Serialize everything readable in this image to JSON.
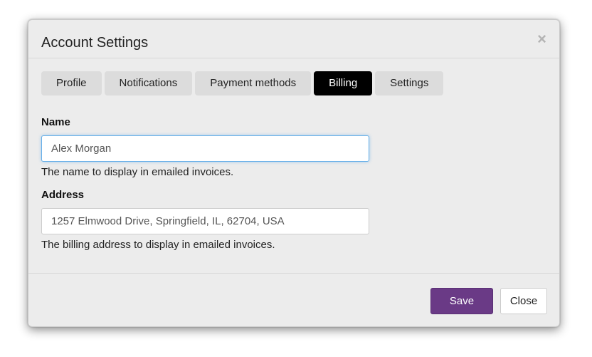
{
  "dialog": {
    "title": "Account Settings",
    "close_symbol": "×"
  },
  "tabs": [
    {
      "label": "Profile",
      "active": false
    },
    {
      "label": "Notifications",
      "active": false
    },
    {
      "label": "Payment methods",
      "active": false
    },
    {
      "label": "Billing",
      "active": true
    },
    {
      "label": "Settings",
      "active": false
    }
  ],
  "form": {
    "name": {
      "label": "Name",
      "value": "Alex Morgan",
      "help": "The name to display in emailed invoices."
    },
    "address": {
      "label": "Address",
      "value": "1257 Elmwood Drive, Springfield, IL, 62704, USA",
      "help": "The billing address to display in emailed invoices."
    }
  },
  "footer": {
    "save_label": "Save",
    "close_label": "Close"
  },
  "colors": {
    "accent": "#6a3a86",
    "active_tab": "#000000",
    "focus_ring": "#66afe9"
  }
}
